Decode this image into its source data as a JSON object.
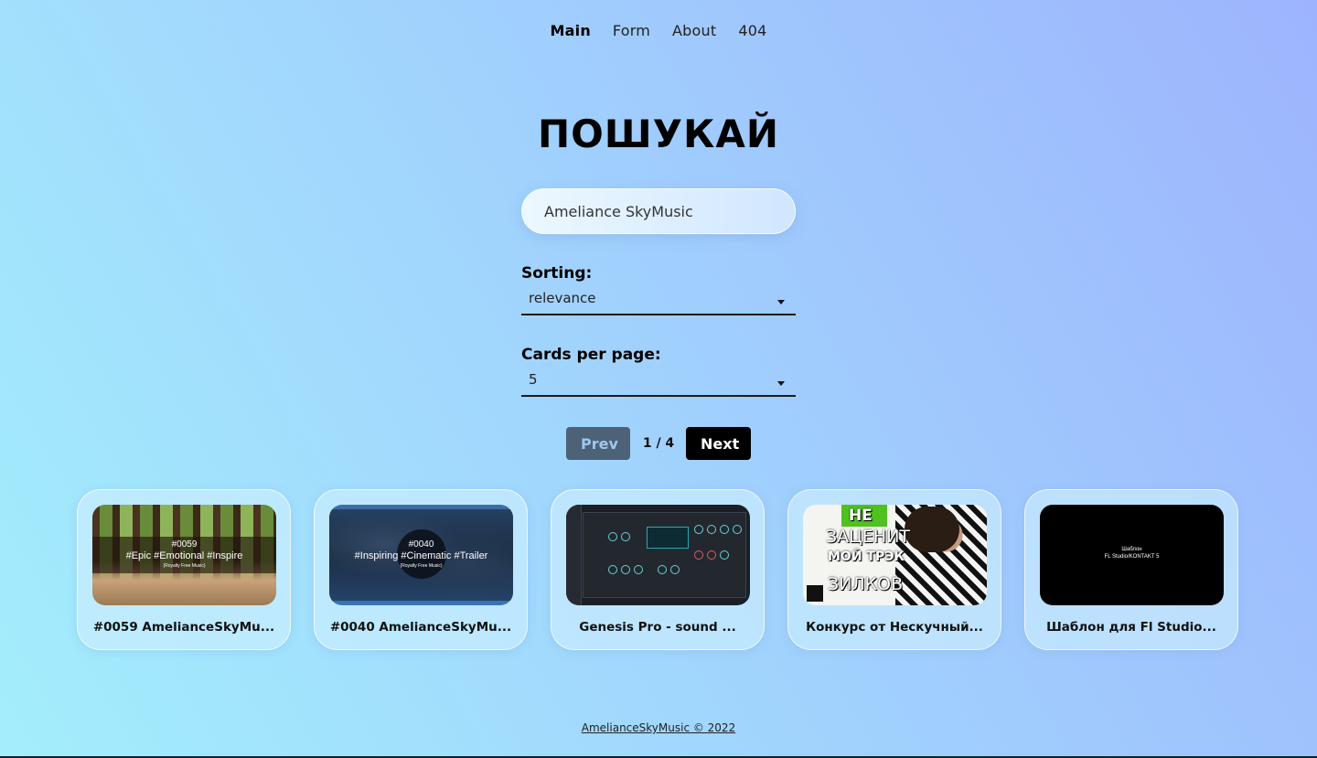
{
  "nav": {
    "items": [
      {
        "label": "Main",
        "active": true
      },
      {
        "label": "Form",
        "active": false
      },
      {
        "label": "About",
        "active": false
      },
      {
        "label": "404",
        "active": false
      }
    ]
  },
  "page": {
    "title": "ПОШУКАЙ"
  },
  "search": {
    "value": "Ameliance SkyMusic"
  },
  "sorting": {
    "label": "Sorting:",
    "value": "relevance"
  },
  "per_page": {
    "label": "Cards per page:",
    "value": "5"
  },
  "pager": {
    "prev_label": "Prev",
    "indicator": "1 / 4",
    "next_label": "Next"
  },
  "cards": [
    {
      "title": "#0059 AmelianceSkyMu...",
      "thumb": {
        "line1": "#0059",
        "line2": "#Epic #Emotional #Inspire",
        "line3": "(Royalty Free Music)"
      }
    },
    {
      "title": "#0040 AmelianceSkyMu...",
      "thumb": {
        "line1": "#0040",
        "line2": "#Inspiring #Cinematic #Trailer",
        "line3": "(Royalty Free Music)"
      }
    },
    {
      "title": "Genesis Pro - sound ...",
      "thumb": {}
    },
    {
      "title": "Конкурс от Нескучный...",
      "thumb": {
        "line1": "НЕ",
        "line2": "ЗАЦЕНИТ",
        "line3": "МОЙ ТРЭК",
        "line4": "ЗИЛКОВ"
      }
    },
    {
      "title": "Шаблон для Fl Studio...",
      "thumb": {
        "line1": "Шаблон",
        "line2": "FL Studio/KONTAKT 5"
      }
    }
  ],
  "footer": {
    "text": "AmelianceSkyMusic © 2022"
  },
  "colors": {
    "prev_bg": "#4d6277",
    "next_bg": "#000000",
    "accent_green": "#4ec21e"
  }
}
